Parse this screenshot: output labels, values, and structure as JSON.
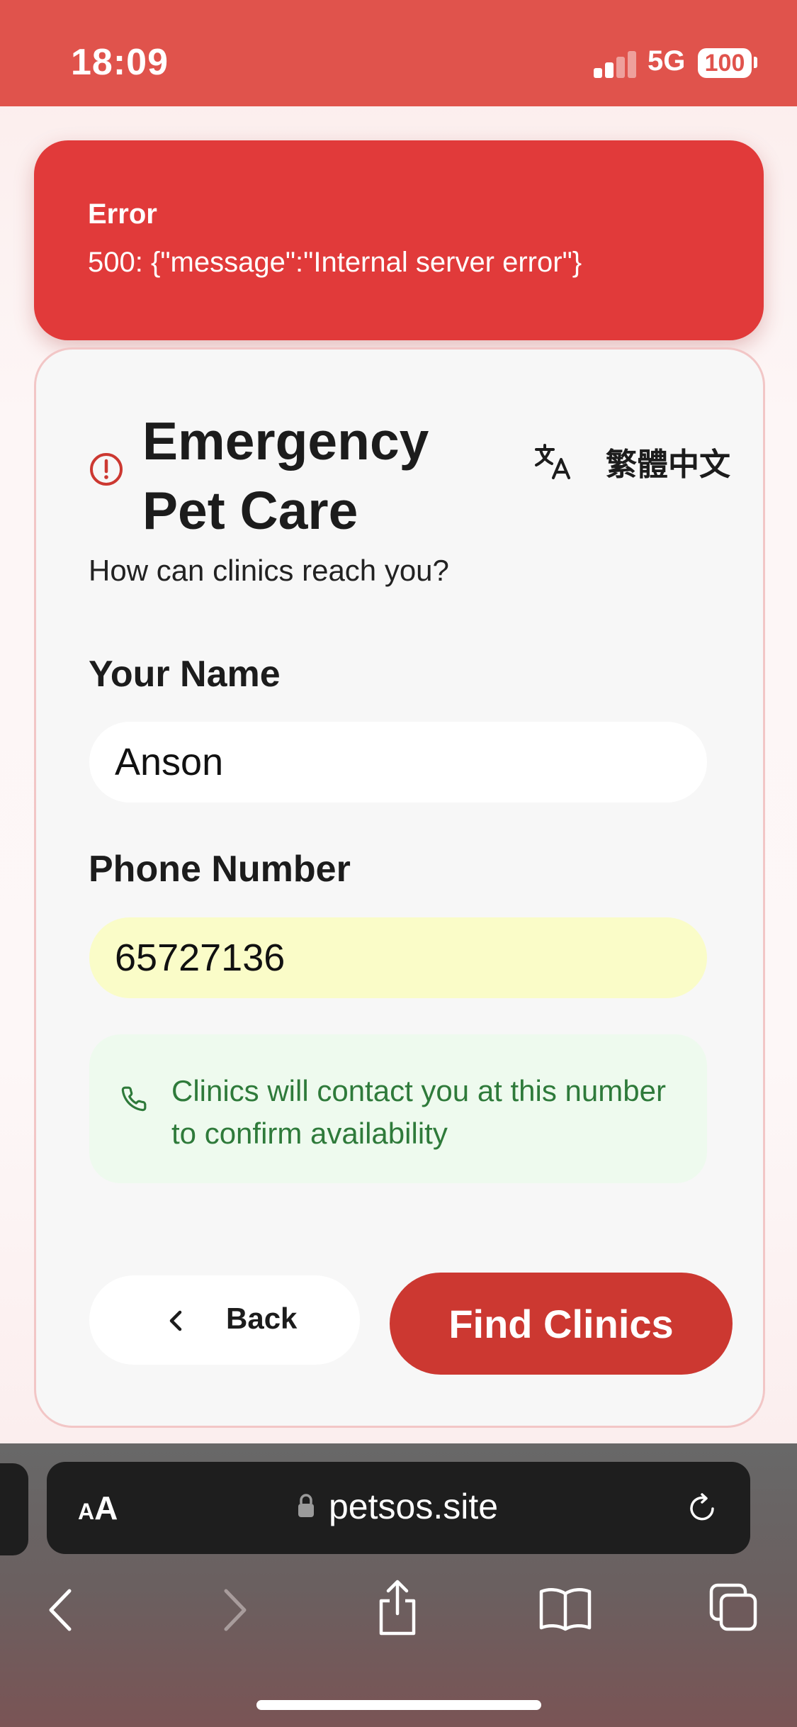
{
  "status_bar": {
    "time": "18:09",
    "network": "5G",
    "battery": "100"
  },
  "error_toast": {
    "title": "Error",
    "message": "500: {\"message\":\"Internal server error\"}"
  },
  "card": {
    "title": "Emergency Pet Care",
    "language_label": "繁體中文",
    "subtitle": "How can clinics reach you?",
    "name_label": "Your Name",
    "name_value": "Anson",
    "phone_label": "Phone Number",
    "phone_value": "65727136",
    "info_text": "Clinics will contact you at this number to confirm availability",
    "back_label": "Back",
    "find_label": "Find Clinics"
  },
  "browser": {
    "text_size_small": "A",
    "text_size_large": "A",
    "url": "petsos.site"
  },
  "colors": {
    "accent": "#cc3831",
    "error": "#e13a3a",
    "status_bar": "#e0534c",
    "info_text": "#2e7a3a",
    "phone_field_bg": "#fafcc8"
  },
  "icons": [
    "alert-circle-icon",
    "translate-icon",
    "phone-icon",
    "chevron-left-icon",
    "lock-icon",
    "reload-icon",
    "back-arrow-icon",
    "forward-arrow-icon",
    "share-icon",
    "bookmarks-icon",
    "tabs-icon",
    "signal-icon"
  ]
}
